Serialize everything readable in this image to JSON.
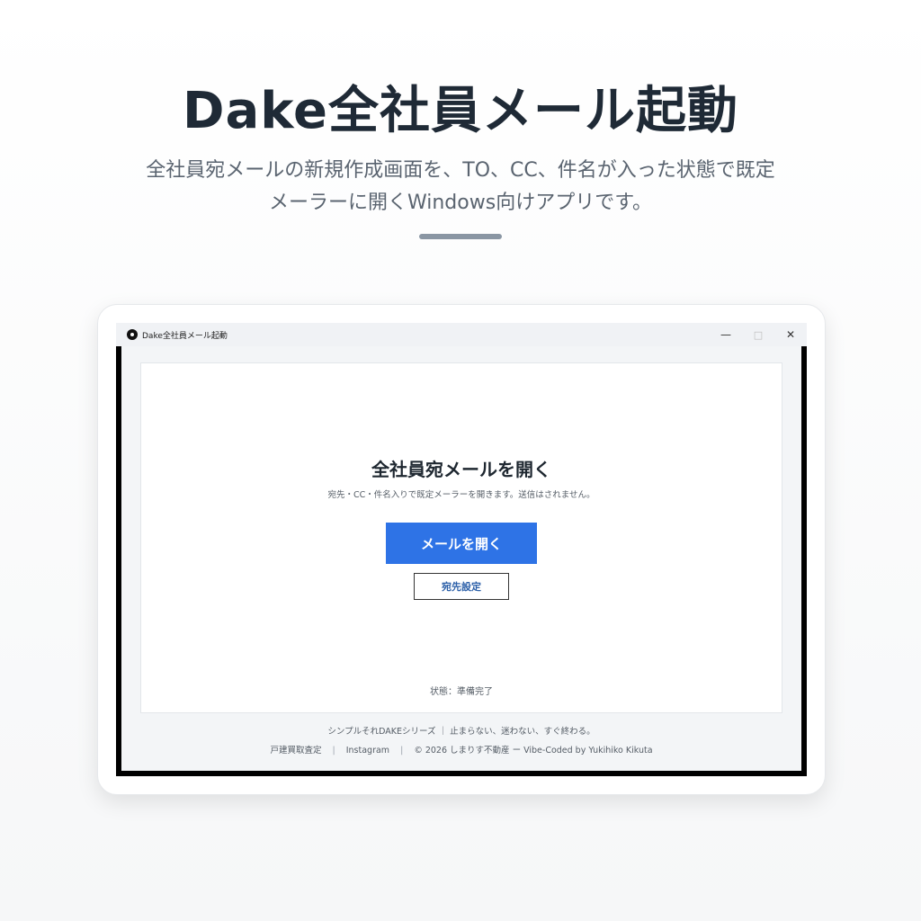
{
  "hero": {
    "title": "Dake全社員メール起動",
    "subtitle_line1": "全社員宛メールの新規作成画面を、TO、CC、件名が入った状態で既定",
    "subtitle_line2": "メーラーに開くWindows向けアプリです。"
  },
  "window": {
    "title": "Dake全社員メール起動",
    "controls": {
      "minimize": "—",
      "maximize": "□",
      "close": "✕"
    }
  },
  "card": {
    "title": "全社員宛メールを開く",
    "description": "宛先・CC・件名入りで既定メーラーを開きます。送信はされません。",
    "primary_button": "メールを開く",
    "secondary_button": "宛先設定",
    "status": "状態：準備完了"
  },
  "footer": {
    "tagline": "シンプルそれDAKEシリーズ ｜ 止まらない、迷わない、すぐ終わる。",
    "links": [
      "戸建買取査定",
      "Instagram"
    ],
    "separator": "|",
    "copyright": "© 2026 しまりす不動産 ー Vibe-Coded by Yukihiko Kikuta"
  },
  "colors": {
    "accent": "#2e73e6",
    "title_text": "#1f2a36"
  }
}
